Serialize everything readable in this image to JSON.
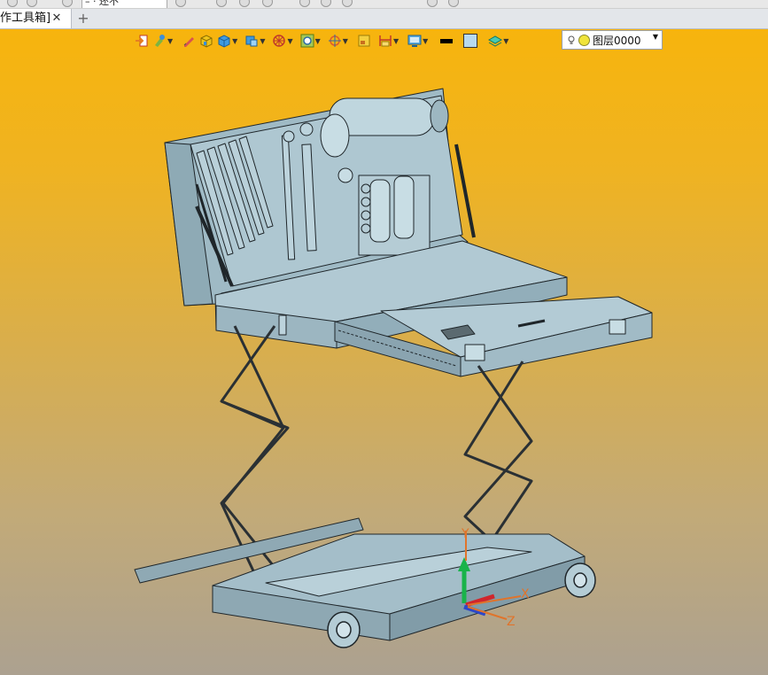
{
  "quick_access": {
    "selector_value": "– · 还不"
  },
  "tabs": [
    {
      "label": "作工具箱]",
      "close": "✕"
    }
  ],
  "new_tab": "+",
  "toolbar": {
    "icons": [
      "import-icon",
      "tools-icon",
      "pen-icon",
      "cube-shaded-icon",
      "cube-view-icon",
      "view-orient-icon",
      "wheel-icon",
      "target-icon",
      "crosshair-icon",
      "box-icon",
      "dimension-icon",
      "monitor-icon",
      "line-color-swatch",
      "fill-color-swatch",
      "layers-icon"
    ],
    "line_color": "#000000",
    "fill_color": "#b7d9ee"
  },
  "layer": {
    "name": "图层0000",
    "bulb": "lightbulb-icon",
    "dot_color": "#f0e43a"
  },
  "triad": {
    "x": "X",
    "y": "Y",
    "z": "Z"
  },
  "colors": {
    "part": "#a9c3cd",
    "edge": "#1f262a",
    "dark": "#2a3034"
  }
}
